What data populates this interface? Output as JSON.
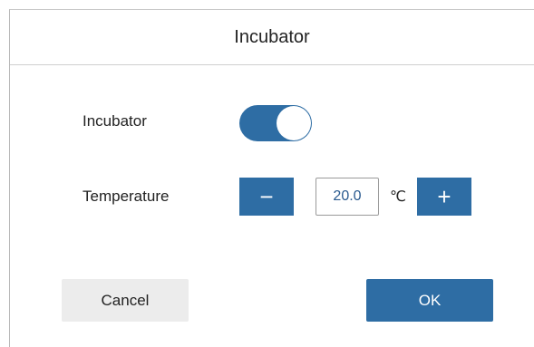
{
  "dialog": {
    "title": "Incubator"
  },
  "incubator_row": {
    "label": "Incubator",
    "toggle_on": true
  },
  "temperature_row": {
    "label": "Temperature",
    "decrement_symbol": "−",
    "value": "20.0",
    "unit": "℃",
    "increment_symbol": "+"
  },
  "actions": {
    "cancel_label": "Cancel",
    "ok_label": "OK"
  },
  "colors": {
    "accent": "#2e6da4",
    "cancel_bg": "#ececec"
  }
}
